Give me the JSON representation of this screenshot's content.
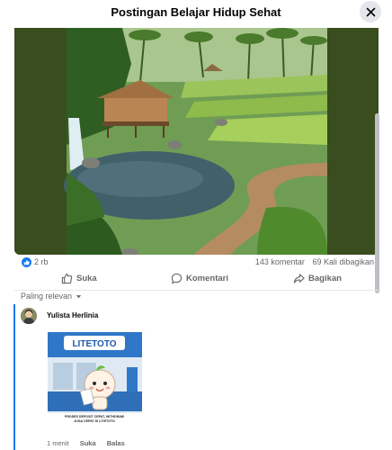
{
  "header": {
    "title": "Postingan Belajar Hidup Sehat"
  },
  "stats": {
    "likes": "2 rb",
    "comments": "143 komentar",
    "shares": "69 Kali dibagikan"
  },
  "actions": {
    "like": "Suka",
    "comment": "Komentari",
    "share": "Bagikan"
  },
  "sort": {
    "label": "Paling relevan"
  },
  "comment": {
    "author": "Yulista Herlinia",
    "sticker_brand": "LITETOTO",
    "sticker_caption_1": "PROSES DEPOSIT CEPAT, WITHDRAW",
    "sticker_caption_2": "JUGA CEPAT DI LITETOTO",
    "time": "1 menit",
    "like": "Suka",
    "reply": "Balas"
  },
  "colors": {
    "accent": "#1877f2",
    "muted": "#65676b",
    "photo_bg": "#3a4d1f"
  }
}
